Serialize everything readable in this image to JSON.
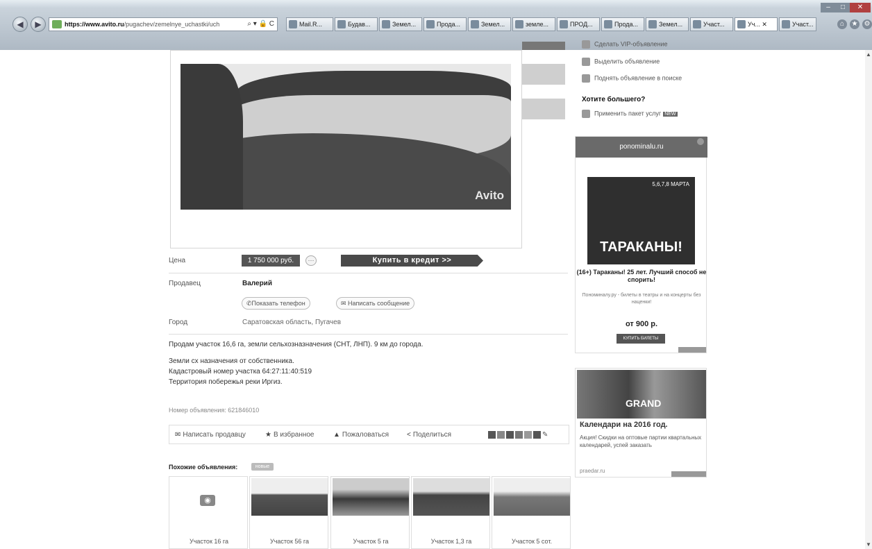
{
  "browser": {
    "address_host": "https://www.avito.ru",
    "address_path": "/pugachev/zemelnye_uchastki/uch",
    "address_controls": "⌕ ▾ 🔒 C",
    "tabs": [
      {
        "label": "Mail.R..."
      },
      {
        "label": "Будав..."
      },
      {
        "label": "Земел..."
      },
      {
        "label": "Прода..."
      },
      {
        "label": "Земел..."
      },
      {
        "label": "земле..."
      },
      {
        "label": "ПРОД..."
      },
      {
        "label": "Прода..."
      },
      {
        "label": "Земел..."
      },
      {
        "label": "Участ..."
      },
      {
        "label": "Уч... ✕"
      },
      {
        "label": "Участ..."
      }
    ]
  },
  "listing": {
    "watermark": "Avito",
    "price_label": "Цена",
    "price_value": "1 750 000 руб.",
    "price_more": "···",
    "credit_button": "Купить в кредит >>",
    "seller_label": "Продавец",
    "seller_name": "Валерий",
    "show_phone": "Показать телефон",
    "write_message": "Написать сообщение",
    "city_label": "Город",
    "city_value": "Саратовская область, Пугачев",
    "desc_line1": "Продам участок 16,6 га, земли сельхозназначения (СНТ, ЛНП). 9 км до города.",
    "desc_line2": "Земли сх назначения от собственника.",
    "desc_line3": "Кадастровый номер участка 64:27:11:40:519",
    "desc_line4": "Территория побережья реки Иргиз.",
    "ad_number": "Номер объявления: 621846010",
    "actions": {
      "write": "Написать продавцу",
      "favorite": "В избранное",
      "report": "Пожаловаться",
      "share": "Поделиться"
    },
    "similar_title": "Похожие объявления:",
    "similar_badge": "новые",
    "similar": [
      {
        "caption": "Участок 16 га"
      },
      {
        "caption": "Участок 56 га"
      },
      {
        "caption": "Участок 5 га"
      },
      {
        "caption": "Участок 1,3 га"
      },
      {
        "caption": "Участок 5 сот."
      }
    ]
  },
  "sidebar": {
    "link_vip": "Сделать VIP-объявление",
    "link_highlight": "Выделить объявление",
    "link_up": "Поднять объявление в поиске",
    "more_title": "Хотите большего?",
    "package": "Применить пакет услуг",
    "package_badge": "NEW"
  },
  "ad1": {
    "site": "ponominalu.ru",
    "poster_title": "ТАРАКАНЫ!",
    "poster_date": "5,6,7,8 МАРТА",
    "headline": "(16+) Тараканы! 25 лет. Лучший способ не спорить!",
    "sub": "Пономиналу.ру - билеты в театры и на концерты без наценки!",
    "price": "от 900 р.",
    "button": "КУПИТЬ БИЛЕТЫ"
  },
  "ad2": {
    "banner_text": "GRAND",
    "title": "Календари на 2016 год.",
    "text": "Акция! Скидки на оптовые партии квартальных календарей, успей заказать",
    "domain": "praedar.ru"
  }
}
